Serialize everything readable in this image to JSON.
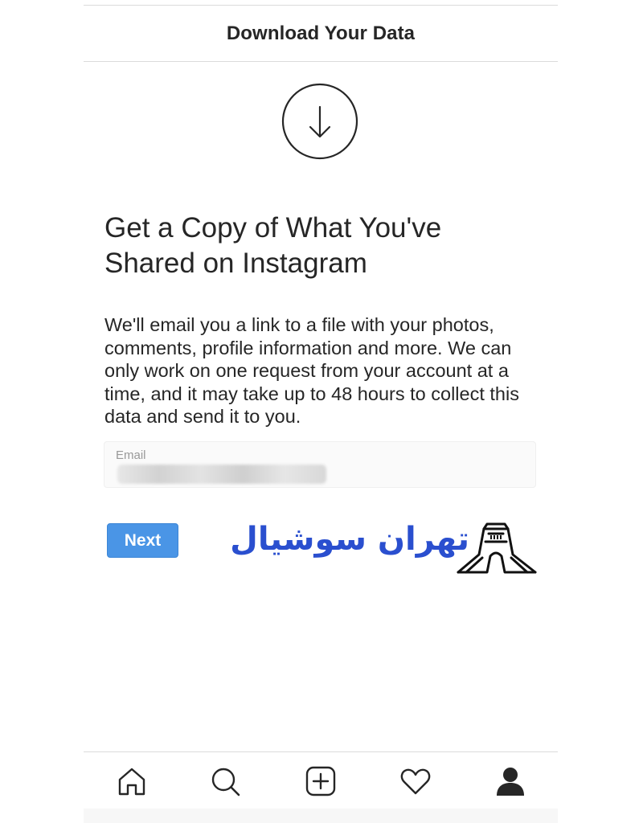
{
  "header": {
    "title": "Download Your Data"
  },
  "main": {
    "headline": "Get a Copy of What You've Shared on Instagram",
    "description": "We'll email you a link to a file with your photos, comments, profile information and more. We can only work on one request from your account at a time, and it may take up to 48 hours to collect this data and send it to you.",
    "email_field": {
      "label": "Email",
      "value": ""
    },
    "next_label": "Next"
  },
  "watermark": {
    "text": "تهران سوشیال",
    "color": "#2a4fcf"
  },
  "tabbar": {
    "tabs": [
      {
        "icon": "home-icon"
      },
      {
        "icon": "search-icon"
      },
      {
        "icon": "add-post-icon"
      },
      {
        "icon": "heart-icon"
      },
      {
        "icon": "profile-icon"
      }
    ]
  },
  "colors": {
    "accent": "#4a95e6",
    "text": "#262626",
    "divider": "#dbdbdb"
  }
}
